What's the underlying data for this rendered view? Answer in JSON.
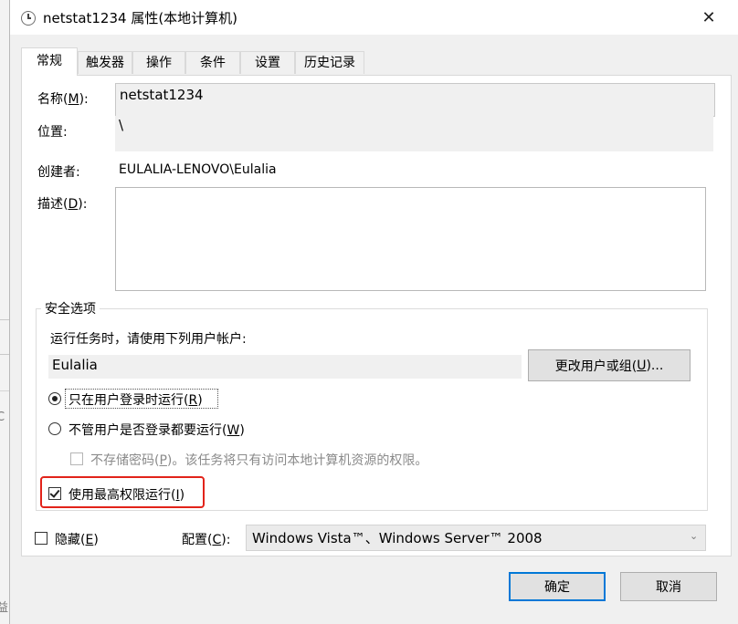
{
  "window": {
    "title": "netstat1234 属性(本地计算机)",
    "close_glyph": "✕"
  },
  "tabs": [
    {
      "label": "常规",
      "active": true
    },
    {
      "label": "触发器"
    },
    {
      "label": "操作"
    },
    {
      "label": "条件"
    },
    {
      "label": "设置"
    },
    {
      "label": "历史记录"
    }
  ],
  "general": {
    "name_label": "名称(",
    "name_key": "M",
    "name_label_end": "):",
    "name_value": "netstat1234",
    "location_label": "位置:",
    "location_value": "\\",
    "creator_label": "创建者:",
    "creator_value": "EULALIA-LENOVO\\Eulalia",
    "description_label": "描述(",
    "description_key": "D",
    "description_label_end": "):",
    "description_value": ""
  },
  "security": {
    "group_title": "安全选项",
    "run_as_label": "运行任务时，请使用下列用户帐户:",
    "user_value": "Eulalia",
    "change_user_button": "更改用户或组(",
    "change_user_key": "U",
    "change_user_end": ")...",
    "radio_logged_on": "只在用户登录时运行(",
    "radio_logged_on_key": "R",
    "radio_logged_on_end": ")",
    "radio_whether": "不管用户是否登录都要运行(",
    "radio_whether_key": "W",
    "radio_whether_end": ")",
    "no_store_password": "不存储密码(",
    "no_store_password_key": "P",
    "no_store_password_end": ")。该任务将只有访问本地计算机资源的权限。",
    "highest_privileges": "使用最高权限运行(",
    "highest_privileges_key": "I",
    "highest_privileges_end": ")"
  },
  "bottom": {
    "hidden_label": "隐藏(",
    "hidden_key": "E",
    "hidden_end": ")",
    "config_label": "配置(",
    "config_key": "C",
    "config_end": "):",
    "config_value": "Windows Vista™、Windows Server™ 2008"
  },
  "buttons": {
    "ok": "确定",
    "cancel": "取消"
  },
  "background": {
    "char1": "C",
    "char2": "益"
  },
  "colors": {
    "accent": "#0078d7",
    "highlight": "#e2231a"
  }
}
